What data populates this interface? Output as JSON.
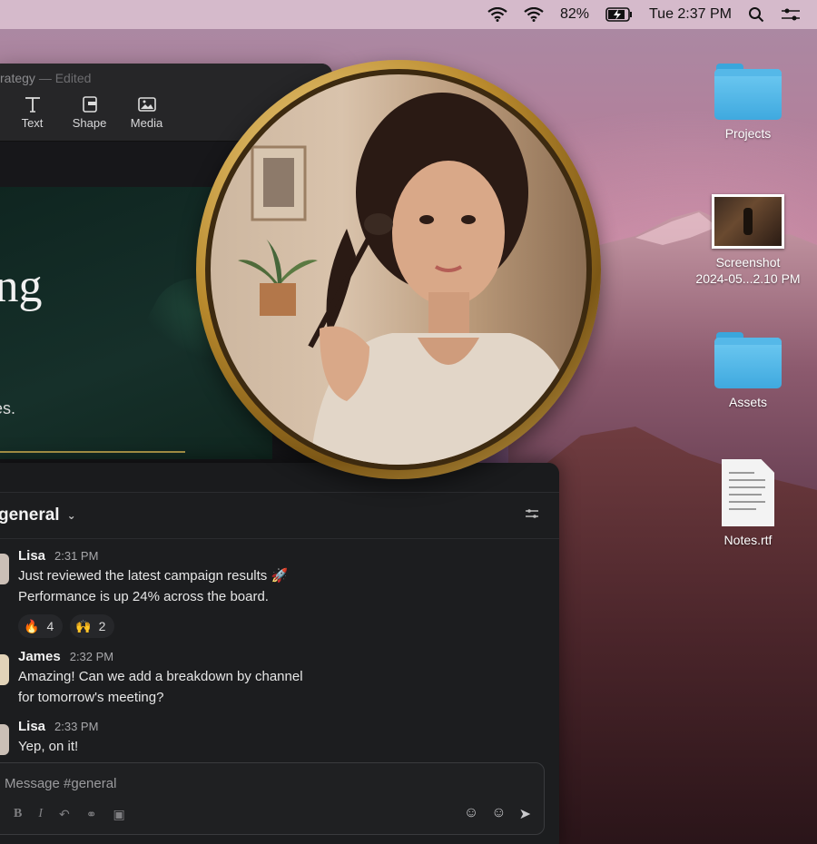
{
  "menubar": {
    "battery": "82%",
    "clock": "Tue 2:37 PM",
    "icons": [
      "wifi-icon",
      "wifi-icon",
      "battery-charging-icon",
      "search-icon",
      "control-center-icon"
    ]
  },
  "desktop": {
    "items": [
      {
        "label": "Projects",
        "type": "folder"
      },
      {
        "label": "Screenshot\n2024-05...2.10 PM",
        "type": "screenshot"
      },
      {
        "label": "Assets",
        "type": "folder"
      },
      {
        "label": "Notes.rtf",
        "type": "document"
      }
    ]
  },
  "keynote": {
    "title": "rategy",
    "edited": "— Edited",
    "toolbar": [
      {
        "label": "Text",
        "icon": "text-icon"
      },
      {
        "label": "Shape",
        "icon": "shape-icon"
      },
      {
        "label": "Media",
        "icon": "media-icon"
      }
    ],
    "slide_title": "ing",
    "slide_subtitle": "ives."
  },
  "slack": {
    "channel": "general",
    "messages": [
      {
        "name": "Lisa",
        "time": "2:31 PM",
        "lines": [
          "Just reviewed the latest campaign results 🚀",
          "Performance is up 24% across the board."
        ],
        "reactions": [
          {
            "emoji": "🔥",
            "count": "4"
          },
          {
            "emoji": "🙌",
            "count": "2"
          }
        ]
      },
      {
        "name": "James",
        "time": "2:32 PM",
        "lines": [
          "Amazing! Can we add a breakdown by channel",
          "for tomorrow's meeting?"
        ]
      },
      {
        "name": "Lisa",
        "time": "2:33 PM",
        "lines": [
          "Yep, on it!"
        ]
      }
    ],
    "composer_placeholder": "Message #general"
  },
  "colors": {
    "folder_blue": "#4fb5e6",
    "frame_gold": "#c89a3a",
    "slide_green": "#16302a"
  }
}
